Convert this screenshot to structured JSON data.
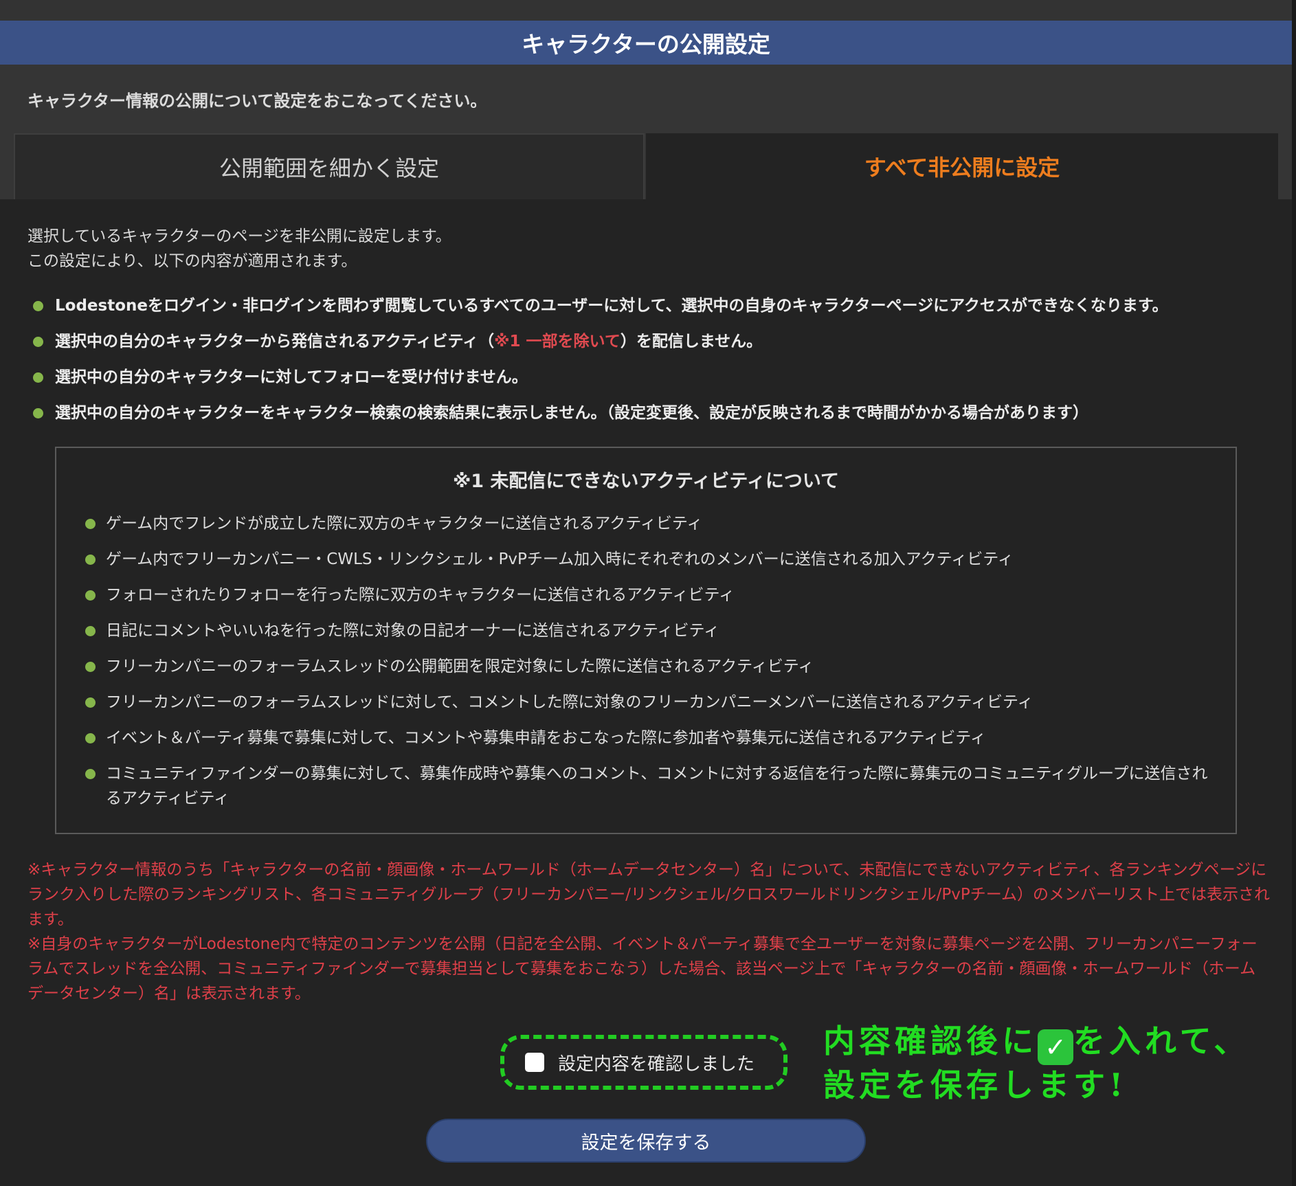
{
  "header": {
    "title": "キャラクターの公開設定"
  },
  "lead": "キャラクター情報の公開について設定をおこなってください。",
  "tabs": [
    {
      "label": "公開範囲を細かく設定",
      "active": false
    },
    {
      "label": "すべて非公開に設定",
      "active": true
    }
  ],
  "intro": [
    "選択しているキャラクターのページを非公開に設定します。",
    "この設定により、以下の内容が適用されます。"
  ],
  "bullets": [
    {
      "text": "Lodestoneをログイン・非ログインを問わず閲覧しているすべてのユーザーに対して、選択中の自身のキャラクターページにアクセスができなくなります。"
    },
    {
      "before": "選択中の自分のキャラクターから発信されるアクティビティ（",
      "highlight": "※1 一部を除いて",
      "after": "）を配信しません。"
    },
    {
      "text": "選択中の自分のキャラクターに対してフォローを受け付けません。"
    },
    {
      "text": "選択中の自分のキャラクターをキャラクター検索の検索結果に表示しません。（設定変更後、設定が反映されるまで時間がかかる場合があります）"
    }
  ],
  "note": {
    "title": "※1 未配信にできないアクティビティについて",
    "items": [
      "ゲーム内でフレンドが成立した際に双方のキャラクターに送信されるアクティビティ",
      "ゲーム内でフリーカンパニー・CWLS・リンクシェル・PvPチーム加入時にそれぞれのメンバーに送信される加入アクティビティ",
      "フォローされたりフォローを行った際に双方のキャラクターに送信されるアクティビティ",
      "日記にコメントやいいねを行った際に対象の日記オーナーに送信されるアクティビティ",
      "フリーカンパニーのフォーラムスレッドの公開範囲を限定対象にした際に送信されるアクティビティ",
      "フリーカンパニーのフォーラムスレッドに対して、コメントした際に対象のフリーカンパニーメンバーに送信されるアクティビティ",
      "イベント＆パーティ募集で募集に対して、コメントや募集申請をおこなった際に参加者や募集元に送信されるアクティビティ",
      "コミュニティファインダーの募集に対して、募集作成時や募集へのコメント、コメントに対する返信を行った際に募集元のコミュニティグループに送信されるアクティビティ"
    ]
  },
  "warnings": [
    "※キャラクター情報のうち「キャラクターの名前・顔画像・ホームワールド（ホームデータセンター）名」について、未配信にできないアクティビティ、各ランキングページにランク入りした際のランキングリスト、各コミュニティグループ（フリーカンパニー/リンクシェル/クロスワールドリンクシェル/PvPチーム）のメンバーリスト上では表示されます。",
    "※自身のキャラクターがLodestone内で特定のコンテンツを公開（日記を全公開、イベント＆パーティ募集で全ユーザーを対象に募集ページを公開、フリーカンパニーフォーラムでスレッドを全公開、コミュニティファインダーで募集担当として募集をおこなう）した場合、該当ページ上で「キャラクターの名前・顔画像・ホームワールド（ホームデータセンター）名」は表示されます。"
  ],
  "confirm": {
    "label": "設定内容を確認しました",
    "checked": false
  },
  "annotation": {
    "line1_before": "内容確認後に",
    "line1_after": "を入れて、",
    "line2": "設定を保存します!"
  },
  "save_button": {
    "label": "設定を保存する"
  },
  "colors": {
    "header": "#3b5287",
    "active_tab": "#ee7d1e",
    "bullet": "#86b64b",
    "warning": "#de4049",
    "annotation": "#22dd22"
  }
}
